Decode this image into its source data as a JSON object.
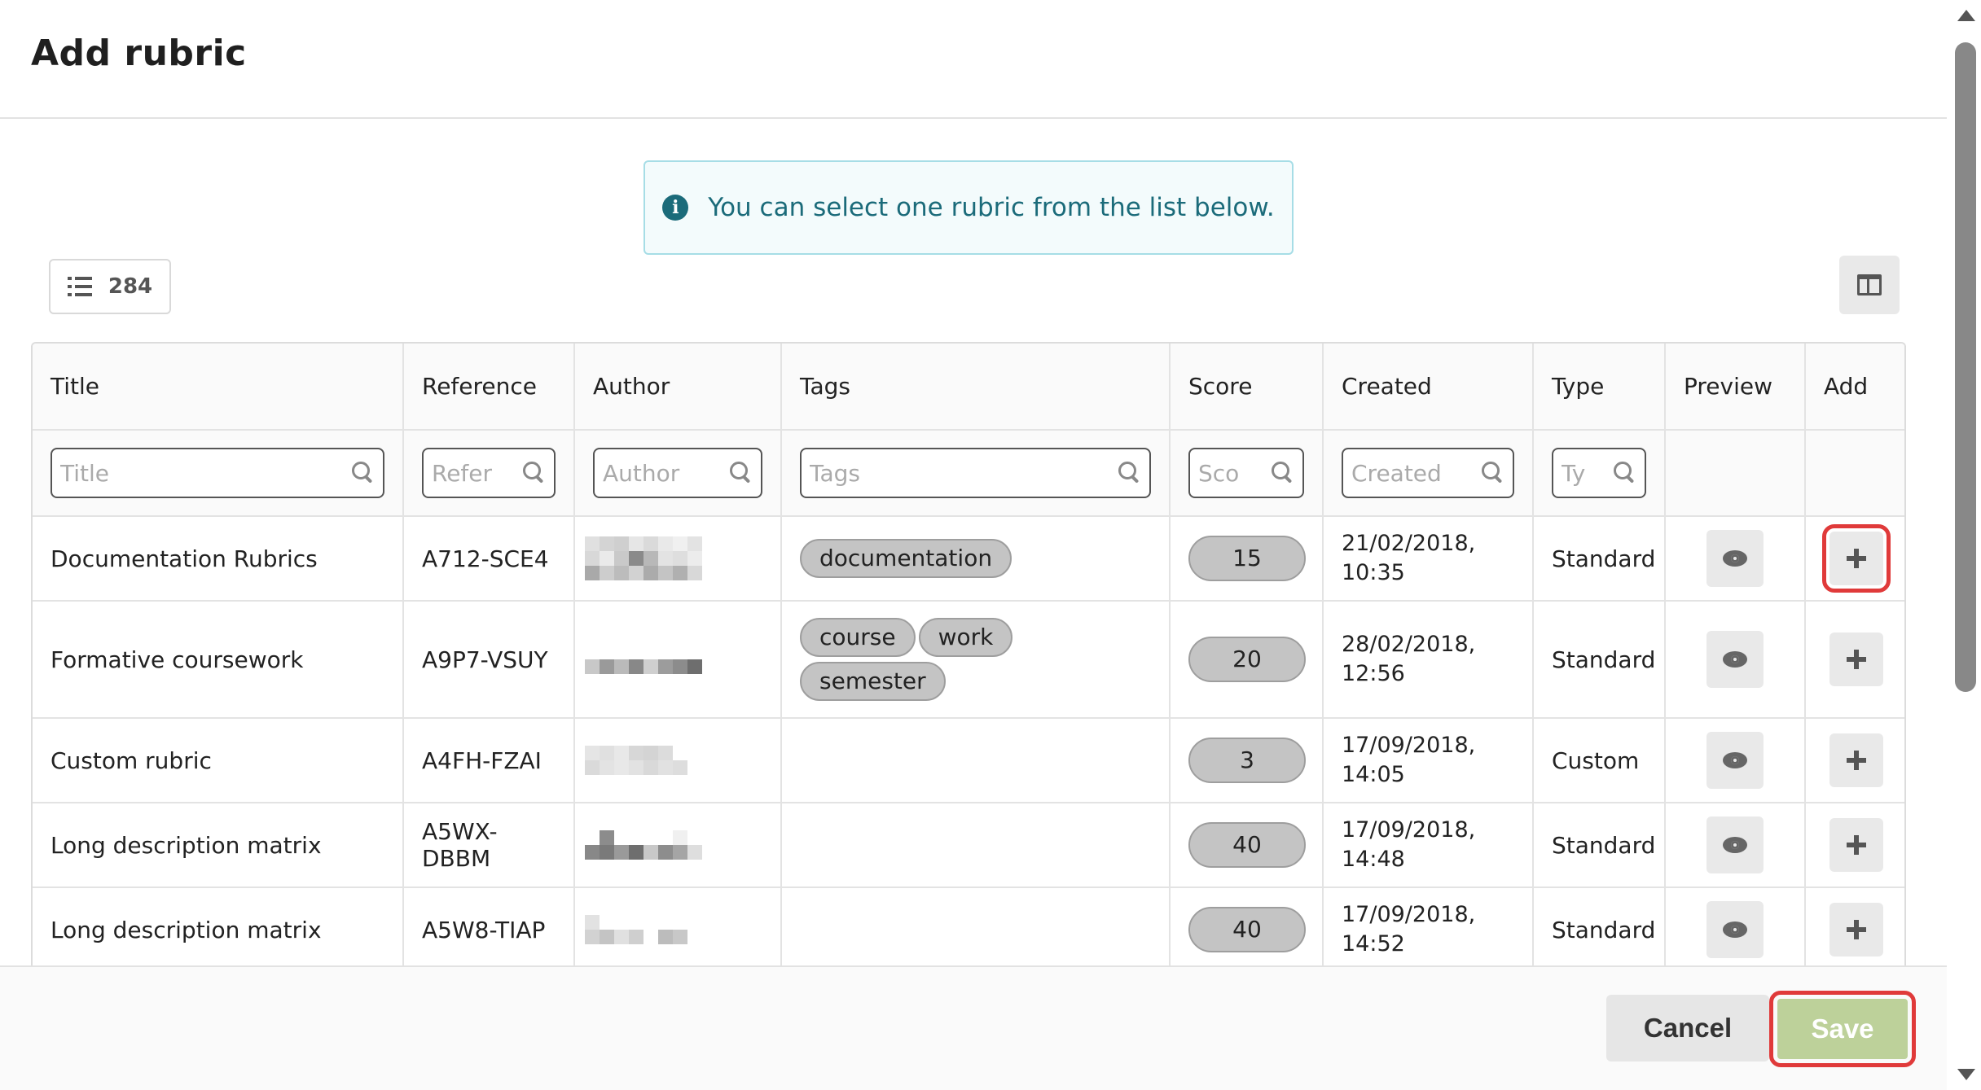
{
  "dialog": {
    "title": "Add rubric"
  },
  "info": {
    "message": "You can select one rubric from the list below."
  },
  "toolbar": {
    "count": "284"
  },
  "table": {
    "headers": {
      "title": "Title",
      "reference": "Reference",
      "author": "Author",
      "tags": "Tags",
      "score": "Score",
      "created": "Created",
      "type": "Type",
      "preview": "Preview",
      "add": "Add"
    },
    "filters": {
      "title": "Title",
      "reference": "Refer",
      "author": "Author",
      "tags": "Tags",
      "score": "Sco",
      "created": "Created",
      "type": "Ty"
    },
    "rows": [
      {
        "title": "Documentation Rubrics",
        "reference": "A712-SCE4",
        "tags": [
          "documentation"
        ],
        "score": "15",
        "created": "21/02/2018,",
        "created_time": "10:35",
        "type": "Standard"
      },
      {
        "title": "Formative coursework",
        "reference": "A9P7-VSUY",
        "tags": [
          "course",
          "work",
          "semester"
        ],
        "score": "20",
        "created": "28/02/2018,",
        "created_time": "12:56",
        "type": "Standard"
      },
      {
        "title": "Custom rubric",
        "reference": "A4FH-FZAI",
        "tags": [],
        "score": "3",
        "created": "17/09/2018,",
        "created_time": "14:05",
        "type": "Custom"
      },
      {
        "title": "Long description matrix",
        "reference": "A5WX-",
        "reference_2": "DBBM",
        "tags": [],
        "score": "40",
        "created": "17/09/2018,",
        "created_time": "14:48",
        "type": "Standard"
      },
      {
        "title": "Long description matrix",
        "reference": "A5W8-TIAP",
        "tags": [],
        "score": "40",
        "created": "17/09/2018,",
        "created_time": "14:52",
        "type": "Standard"
      }
    ]
  },
  "footer": {
    "cancel_label": "Cancel",
    "save_label": "Save"
  },
  "icons": {
    "info": "info-icon",
    "list": "list-icon",
    "columns": "columns-icon",
    "search": "search-icon",
    "eye": "eye-icon",
    "plus": "plus-icon"
  },
  "colors": {
    "info_text": "#1b6b7a",
    "save_bg": "#bdd19a",
    "highlight": "#e03a3a"
  }
}
